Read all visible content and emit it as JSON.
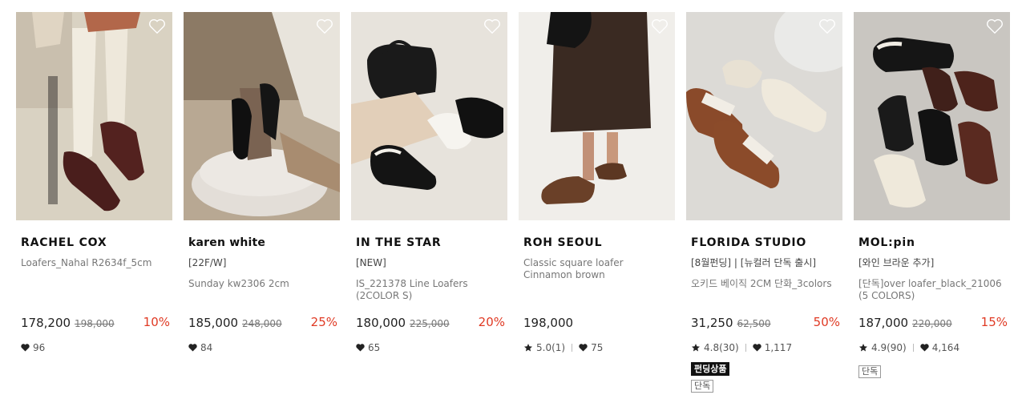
{
  "products": [
    {
      "brand": "RACHEL COX",
      "tag": "",
      "name": "Loafers_Nahal R2634f_5cm",
      "price": "178,200",
      "original_price": "198,000",
      "discount": "10%",
      "rating": "",
      "likes": "96",
      "badges": [],
      "image_icon": "wishlist-heart-icon"
    },
    {
      "brand": "karen white",
      "tag": "[22F/W]",
      "name": "Sunday kw2306 2cm",
      "price": "185,000",
      "original_price": "248,000",
      "discount": "25%",
      "rating": "",
      "likes": "84",
      "badges": []
    },
    {
      "brand": "IN THE STAR",
      "tag": "[NEW]",
      "name": "IS_221378 Line Loafers (2COLOR S)",
      "price": "180,000",
      "original_price": "225,000",
      "discount": "20%",
      "rating": "",
      "likes": "65",
      "badges": []
    },
    {
      "brand": "ROH SEOUL",
      "tag": "",
      "name": "Classic square loafer Cinnamon brown",
      "price": "198,000",
      "original_price": "",
      "discount": "",
      "rating": "5.0(1)",
      "likes": "75",
      "badges": []
    },
    {
      "brand": "FLORIDA STUDIO",
      "tag": "[8월펀딩] | [뉴컬러 단독 출시]",
      "name": "오키드 베이직 2CM 단화_3colors",
      "price": "31,250",
      "original_price": "62,500",
      "discount": "50%",
      "rating": "4.8(30)",
      "likes": "1,117",
      "badges": [
        "펀딩상품",
        "단독"
      ]
    },
    {
      "brand": "MOL:pin",
      "tag": "[와인 브라운 추가]",
      "name": "[단독]over loafer_black_21006 (5 COLORS)",
      "price": "187,000",
      "original_price": "220,000",
      "discount": "15%",
      "rating": "4.9(90)",
      "likes": "4,164",
      "badges": [
        "단독"
      ]
    }
  ],
  "colors": {
    "discount": "#e03a24",
    "brand_text": "#111111",
    "muted_text": "#777777"
  }
}
